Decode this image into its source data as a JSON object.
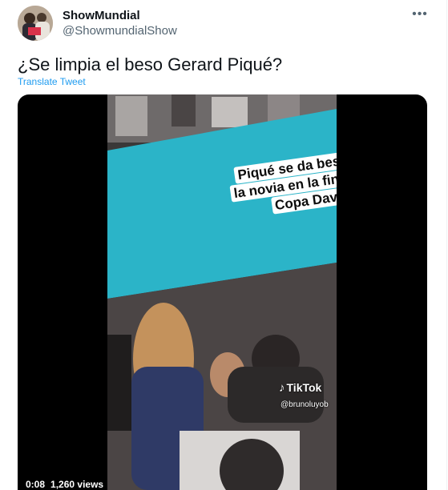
{
  "author": {
    "name": "ShowMundial",
    "handle": "@ShowmundialShow",
    "avatar_icon": "user-avatar"
  },
  "more_icon": "more-dots-icon",
  "tweet": {
    "text": "¿Se limpia el beso Gerard Piqué?",
    "translate_label": "Translate Tweet"
  },
  "video": {
    "caption": [
      "Piqué se da beso con",
      "la novia en la final de la",
      "Copa Davis"
    ],
    "watermark": "TikTok",
    "watermark_user": "@brunoluyob",
    "elapsed": "0:08",
    "views": "1,260 views"
  },
  "colors": {
    "link": "#1d9bf0",
    "screen": "#2bb4c8",
    "text_secondary": "#536471"
  }
}
